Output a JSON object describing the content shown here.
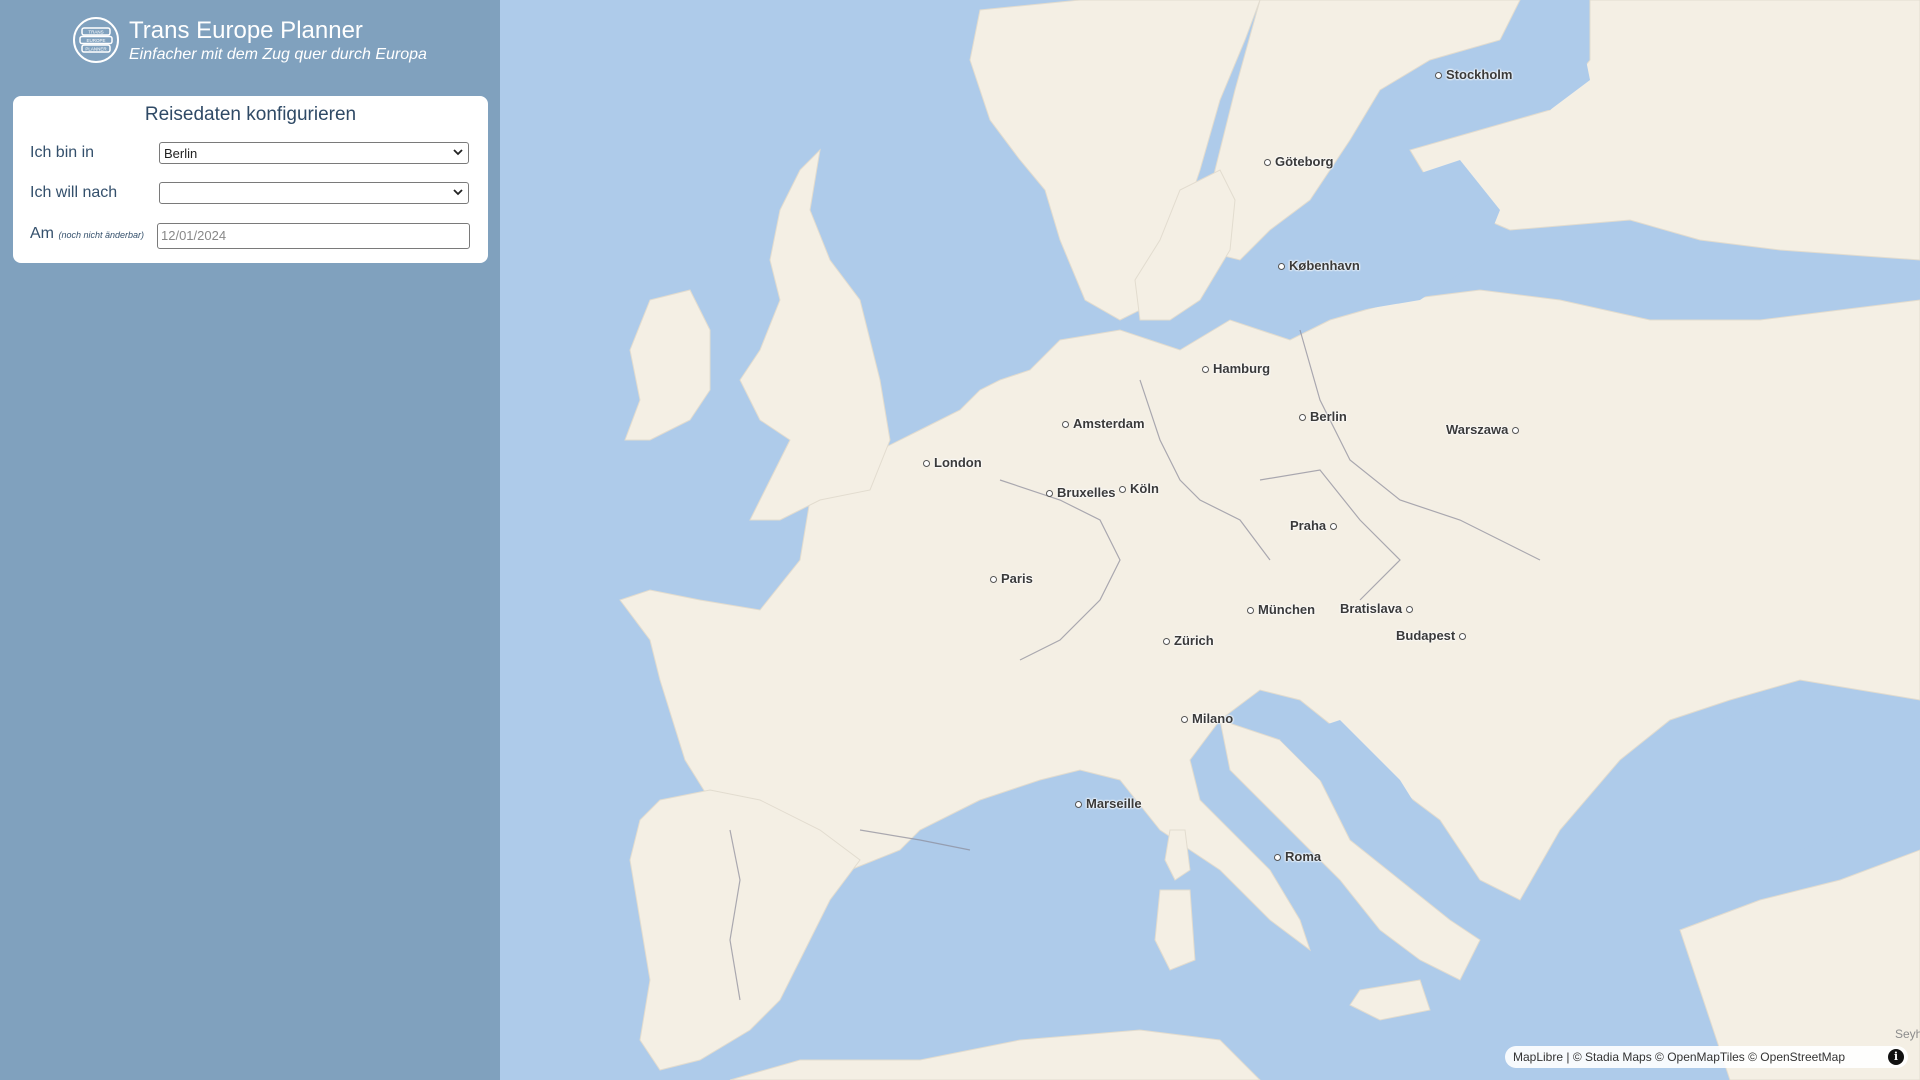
{
  "app": {
    "title": "Trans Europe Planner",
    "subtitle": "Einfacher mit dem Zug quer durch Europa",
    "logo_lines": [
      "TRANS",
      "EUROPE",
      "PLANNER"
    ]
  },
  "panel": {
    "heading": "Reisedaten konfigurieren",
    "from": {
      "label": "Ich bin in",
      "value": "Berlin"
    },
    "to": {
      "label": "Ich will nach",
      "value": ""
    },
    "date": {
      "label": "Am",
      "note": "(noch nicht änderbar)",
      "placeholder": "12/01/2024"
    }
  },
  "map": {
    "cities": [
      "Stockholm",
      "Göteborg",
      "København",
      "Hamburg",
      "Berlin",
      "Warszawa",
      "Amsterdam",
      "London",
      "Bruxelles",
      "Köln",
      "Praha",
      "Paris",
      "München",
      "Bratislava",
      "Budapest",
      "Zürich",
      "Milano",
      "Marseille",
      "Roma"
    ],
    "corner_label": "Seyh",
    "attribution": {
      "maplibre": "MapLibre",
      "rest": " | © Stadia Maps © OpenMapTiles © OpenStreetMap",
      "info_icon": "i"
    }
  },
  "colors": {
    "sidebar": "#80a1be",
    "water": "#aecbea",
    "land": "#f4efe4",
    "heading": "#2f4a66"
  }
}
